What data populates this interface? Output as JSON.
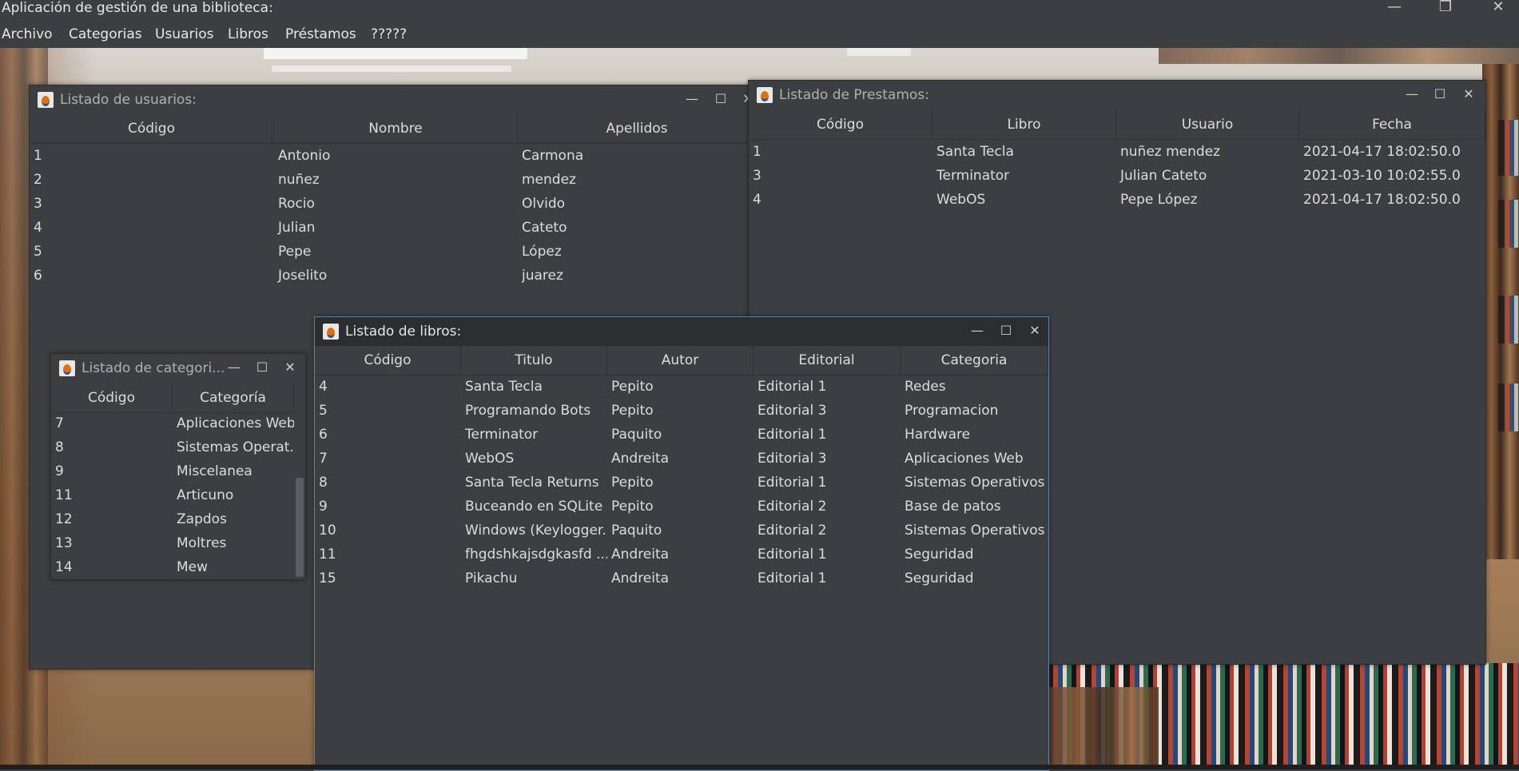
{
  "app": {
    "title": "Aplicación de gestión de una biblioteca:",
    "controls": {
      "minimize": "—",
      "restore": "❐",
      "close": "✕"
    }
  },
  "menu": [
    "Archivo",
    "Categorias",
    "Usuarios",
    "Libros",
    "Préstamos",
    "?????"
  ],
  "windows": {
    "usuarios": {
      "title": "Listado de usuarios:",
      "columns": [
        "Código",
        "Nombre",
        "Apellidos"
      ],
      "rows": [
        [
          "1",
          "Antonio",
          "Carmona"
        ],
        [
          "2",
          "nuñez",
          "mendez"
        ],
        [
          "3",
          "Rocio",
          "Olvido"
        ],
        [
          "4",
          "Julian",
          "Cateto"
        ],
        [
          "5",
          "Pepe",
          "López"
        ],
        [
          "6",
          "Joselito",
          "juarez"
        ]
      ]
    },
    "prestamos": {
      "title": "Listado de Prestamos:",
      "columns": [
        "Código",
        "Libro",
        "Usuario",
        "Fecha"
      ],
      "rows": [
        [
          "1",
          "Santa Tecla",
          "nuñez mendez",
          "2021-04-17 18:02:50.0"
        ],
        [
          "3",
          "Terminator",
          "Julian Cateto",
          "2021-03-10 10:02:55.0"
        ],
        [
          "4",
          "WebOS",
          "Pepe López",
          "2021-04-17 18:02:50.0"
        ]
      ]
    },
    "categorias": {
      "title": "Listado de categori...",
      "columns": [
        "Código",
        "Categoría"
      ],
      "rows": [
        [
          "7",
          "Aplicaciones Web"
        ],
        [
          "8",
          "Sistemas Operat..."
        ],
        [
          "9",
          "Miscelanea"
        ],
        [
          "11",
          "Articuno"
        ],
        [
          "12",
          "Zapdos"
        ],
        [
          "13",
          "Moltres"
        ],
        [
          "14",
          "Mew"
        ]
      ]
    },
    "libros": {
      "title": "Listado de libros:",
      "columns": [
        "Código",
        "Titulo",
        "Autor",
        "Editorial",
        "Categoria"
      ],
      "rows": [
        [
          "4",
          "Santa Tecla",
          "Pepito",
          "Editorial 1",
          "Redes"
        ],
        [
          "5",
          "Programando Bots",
          "Pepito",
          "Editorial 3",
          "Programacion"
        ],
        [
          "6",
          "Terminator",
          "Paquito",
          "Editorial 1",
          "Hardware"
        ],
        [
          "7",
          "WebOS",
          "Andreita",
          "Editorial 3",
          "Aplicaciones Web"
        ],
        [
          "8",
          "Santa Tecla Returns",
          "Pepito",
          "Editorial 1",
          "Sistemas Operativos"
        ],
        [
          "9",
          "Buceando en SQLite",
          "Pepito",
          "Editorial 2",
          "Base de patos"
        ],
        [
          "10",
          "Windows (Keylogger...",
          "Paquito",
          "Editorial 2",
          "Sistemas Operativos"
        ],
        [
          "11",
          "fhgdshkajsdgkasfd ...",
          "Andreita",
          "Editorial 1",
          "Seguridad"
        ],
        [
          "15",
          "Pikachu",
          "Andreita",
          "Editorial 1",
          "Seguridad"
        ]
      ]
    }
  },
  "internal_controls": {
    "minimize": "—",
    "maximize": "☐",
    "close": "✕"
  },
  "colors": {
    "panel": "#3c3f41",
    "title_active": "#2b2d2f",
    "text": "#dcdcdc",
    "active_border": "#5e83a8"
  }
}
